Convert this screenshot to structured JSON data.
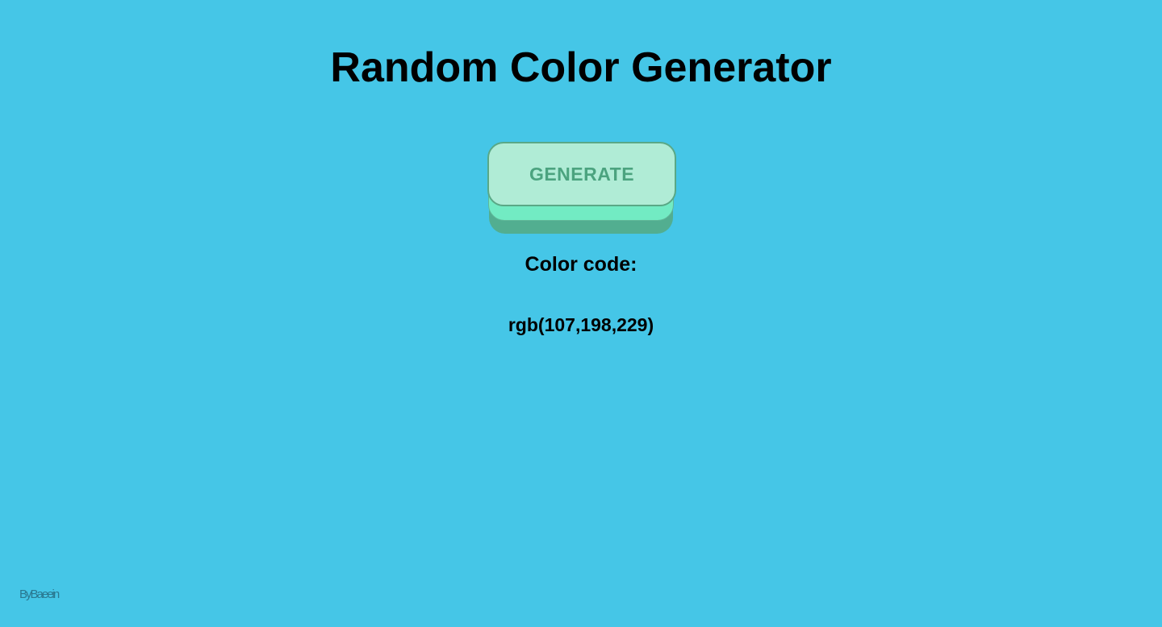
{
  "page": {
    "title": "Random Color Generator",
    "background_color": "#45c6e7"
  },
  "generator": {
    "button_label": "GENERATE",
    "code_label": "Color code:",
    "code_value": "rgb(107,198,229)"
  },
  "footer": {
    "credit": "ByBaeein"
  },
  "colors": {
    "button_face": "#b0ecd6",
    "button_text": "#4ba37f",
    "button_mid": "#72ebc3",
    "button_base": "#52ae90"
  }
}
